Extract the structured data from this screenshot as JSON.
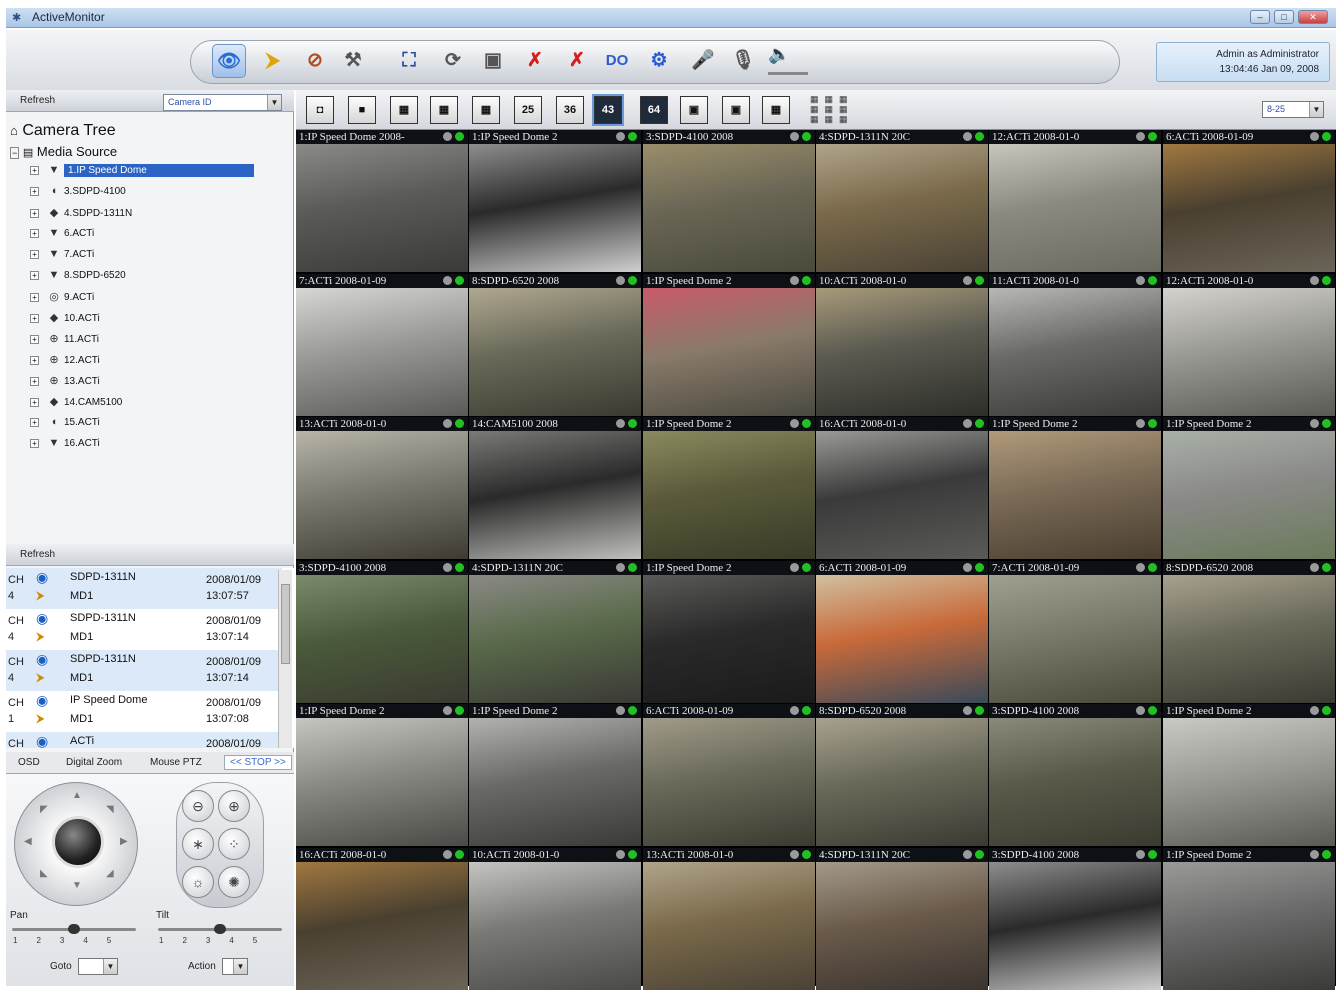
{
  "window": {
    "title": "ActiveMonitor"
  },
  "user": {
    "line1": "Admin as Administrator",
    "line2": "13:04:46 Jan 09, 2008"
  },
  "toolbar": {
    "buttons": [
      {
        "icon": "eye-icon",
        "glyph": "👁",
        "color": "#2a6cd4"
      },
      {
        "icon": "alarm-tag-icon",
        "glyph": "⮞",
        "color": "#e0a400"
      },
      {
        "icon": "map-edit-icon",
        "glyph": "⊘",
        "color": "#b05020"
      },
      {
        "icon": "tools-icon",
        "glyph": "⚒",
        "color": "#555"
      },
      {
        "icon": "fullscreen-icon",
        "glyph": "⛶",
        "color": "#2a4f9a"
      },
      {
        "icon": "sequence-icon",
        "glyph": "⟳",
        "color": "#555"
      },
      {
        "icon": "snapshot-icon",
        "glyph": "▣",
        "color": "#555"
      },
      {
        "icon": "disconnect-icon",
        "glyph": "✗",
        "color": "#d02020"
      },
      {
        "icon": "disconnect-all-icon",
        "glyph": "✗",
        "color": "#d02020"
      },
      {
        "icon": "digital-output-icon",
        "glyph": "DO",
        "color": "#2a5bd0"
      },
      {
        "icon": "settings-icon",
        "glyph": "⚙",
        "color": "#2a5bd0"
      },
      {
        "icon": "microphone-icon",
        "glyph": "🎤",
        "color": "#555"
      },
      {
        "icon": "talk-icon",
        "glyph": "🎙",
        "color": "#555"
      }
    ],
    "speaker_icon": "speaker-icon"
  },
  "left": {
    "header_refresh": "Refresh",
    "sort_select": "Camera ID",
    "tree_root": "Camera Tree",
    "media_source": "Media Source",
    "nodes": [
      {
        "label": "1.IP Speed Dome",
        "icon": "dome-camera-icon",
        "glyph": "▼",
        "selected": true
      },
      {
        "label": "3.SDPD-4100",
        "icon": "box-camera-icon",
        "glyph": "◖"
      },
      {
        "label": "4.SDPD-1311N",
        "icon": "bullet-camera-icon",
        "glyph": "◆"
      },
      {
        "label": "6.ACTi",
        "icon": "dome-camera-icon",
        "glyph": "▼"
      },
      {
        "label": "7.ACTi",
        "icon": "dome-camera-icon",
        "glyph": "▼"
      },
      {
        "label": "8.SDPD-6520",
        "icon": "dome-camera-icon",
        "glyph": "▼"
      },
      {
        "label": "9.ACTi",
        "icon": "wireless-camera-icon",
        "glyph": "◎"
      },
      {
        "label": "10.ACTi",
        "icon": "bullet-camera-icon",
        "glyph": "◆"
      },
      {
        "label": "11.ACTi",
        "icon": "network-camera-icon",
        "glyph": "⊕"
      },
      {
        "label": "12.ACTi",
        "icon": "network-camera-icon",
        "glyph": "⊕"
      },
      {
        "label": "13.ACTi",
        "icon": "network-camera-icon",
        "glyph": "⊕"
      },
      {
        "label": "14.CAM5100",
        "icon": "bullet-camera-icon",
        "glyph": "◆"
      },
      {
        "label": "15.ACTi",
        "icon": "box-camera-icon",
        "glyph": "◖"
      },
      {
        "label": "16.ACTi",
        "icon": "dome-camera-icon",
        "glyph": "▼"
      }
    ],
    "events_refresh": "Refresh",
    "events": [
      {
        "ch": "CH",
        "num": "4",
        "device": "SDPD-1311N",
        "trigger": "MD1",
        "date": "2008/01/09",
        "time": "13:07:57",
        "hl": true
      },
      {
        "ch": "CH",
        "num": "4",
        "device": "SDPD-1311N",
        "trigger": "MD1",
        "date": "2008/01/09",
        "time": "13:07:14",
        "hl": false
      },
      {
        "ch": "CH",
        "num": "4",
        "device": "SDPD-1311N",
        "trigger": "MD1",
        "date": "2008/01/09",
        "time": "13:07:14",
        "hl": true
      },
      {
        "ch": "CH",
        "num": "1",
        "device": "IP Speed Dome",
        "trigger": "MD1",
        "date": "2008/01/09",
        "time": "13:07:08",
        "hl": false
      },
      {
        "ch": "CH",
        "num": "",
        "device": "ACTi",
        "trigger": "",
        "date": "2008/01/09",
        "time": "",
        "hl": true
      }
    ],
    "ptz_tabs": {
      "osd": "OSD",
      "digital_zoom": "Digital Zoom",
      "mouse_ptz": "Mouse PTZ",
      "stop": "<< STOP >>"
    },
    "ptz": {
      "pan_label": "Pan",
      "tilt_label": "Tilt",
      "pan_ticks": "12345",
      "tilt_ticks": "12345",
      "goto_label": "Goto",
      "action_label": "Action"
    }
  },
  "view": {
    "layouts": [
      {
        "label": "◘",
        "icon": "layout-cycle-icon",
        "dark": false
      },
      {
        "label": "■",
        "icon": "layout-1-icon",
        "dark": false
      },
      {
        "label": "▦",
        "icon": "layout-4-icon",
        "dark": false
      },
      {
        "label": "▦",
        "icon": "layout-9-icon",
        "dark": false
      },
      {
        "label": "▦",
        "icon": "layout-16-icon",
        "dark": false
      },
      {
        "label": "25",
        "icon": "layout-25-icon",
        "dark": false
      },
      {
        "label": "36",
        "icon": "layout-36-icon",
        "dark": false
      },
      {
        "label": "43",
        "icon": "layout-43-icon",
        "dark": true
      },
      {
        "label": "64",
        "icon": "layout-64-icon",
        "dark": true
      },
      {
        "label": "▣",
        "icon": "layout-1plus5-icon",
        "dark": false
      },
      {
        "label": "▣",
        "icon": "layout-1plus7-icon",
        "dark": false
      },
      {
        "label": "▦",
        "icon": "layout-1plus12-icon",
        "dark": false
      }
    ],
    "page_select": "8-25"
  },
  "cells": [
    {
      "cap": "1:IP Speed Dome   2008-",
      "g": [
        "#5a5a58",
        "#8a8a86",
        "#3a3a38"
      ],
      "sel": true
    },
    {
      "cap": "1:IP Speed Dome   2",
      "g": [
        "#2a2a2a",
        "#8e8e8e",
        "#cfcfcf"
      ]
    },
    {
      "cap": "3:SDPD-4100   2008",
      "g": [
        "#6a6656",
        "#9a8e6a",
        "#4a4a3a"
      ]
    },
    {
      "cap": "4:SDPD-1311N   20C",
      "g": [
        "#7a6a4a",
        "#b0a48a",
        "#4a4236"
      ]
    },
    {
      "cap": "12:ACTi   2008-01-0",
      "g": [
        "#8a8a80",
        "#c9c6bb",
        "#6a6a60"
      ]
    },
    {
      "cap": "6:ACTi   2008-01-09",
      "g": [
        "#4a4030",
        "#a07840",
        "#6a6458"
      ]
    },
    {
      "cap": "7:ACTi   2008-01-09",
      "g": [
        "#9a9a96",
        "#d6d6d2",
        "#5a5a56"
      ]
    },
    {
      "cap": "8:SDPD-6520   2008",
      "g": [
        "#6a6a5a",
        "#b0a890",
        "#3a3a30"
      ]
    },
    {
      "cap": "1:IP Speed Dome   2",
      "g": [
        "#8a7a6a",
        "#c85a6a",
        "#4a4a40"
      ]
    },
    {
      "cap": "10:ACTi   2008-01-0",
      "g": [
        "#5a5a50",
        "#a89a7a",
        "#2e2e2a"
      ]
    },
    {
      "cap": "11:ACTi   2008-01-0",
      "g": [
        "#6a6a66",
        "#b8b8b4",
        "#3a3a36"
      ]
    },
    {
      "cap": "12:ACTi   2008-01-0",
      "g": [
        "#9a9a94",
        "#d4d2cc",
        "#5a5a54"
      ]
    },
    {
      "cap": "13:ACTi   2008-01-0",
      "g": [
        "#7a7a70",
        "#b8b4a8",
        "#3e3a32"
      ]
    },
    {
      "cap": "14:CAM5100   2008",
      "g": [
        "#2a2a2a",
        "#7a7a78",
        "#c0c0bc"
      ]
    },
    {
      "cap": "1:IP Speed Dome   2",
      "g": [
        "#5a5a3a",
        "#8a8a60",
        "#3a3a28"
      ]
    },
    {
      "cap": "16:ACTi   2008-01-0",
      "g": [
        "#3a3a3a",
        "#9a9a98",
        "#5a5a58"
      ]
    },
    {
      "cap": "1:IP Speed Dome   2",
      "g": [
        "#7a6a56",
        "#b09a7a",
        "#4a3e30"
      ]
    },
    {
      "cap": "1:IP Speed Dome   2",
      "g": [
        "#8a8a88",
        "#a9b0a8",
        "#6a7a5a"
      ]
    },
    {
      "cap": "3:SDPD-4100   2008",
      "g": [
        "#4a5a3a",
        "#7a8a6a",
        "#3a3a30"
      ]
    },
    {
      "cap": "4:SDPD-1311N   20C",
      "g": [
        "#5a6a4a",
        "#8a8a86",
        "#3a3a36"
      ]
    },
    {
      "cap": "1:IP Speed Dome   2",
      "g": [
        "#2a2a2a",
        "#5a5a58",
        "#1a1a1a"
      ]
    },
    {
      "cap": "6:ACTi   2008-01-09",
      "g": [
        "#c86a3a",
        "#d0c0a0",
        "#3a4a5a"
      ]
    },
    {
      "cap": "7:ACTi   2008-01-09",
      "g": [
        "#7a7a6a",
        "#a0a090",
        "#4a4a3a"
      ]
    },
    {
      "cap": "8:SDPD-6520   2008",
      "g": [
        "#6a6a5a",
        "#a8a090",
        "#3a3a32"
      ]
    },
    {
      "cap": "1:IP Speed Dome   2",
      "g": [
        "#8a8a84",
        "#c6c6c0",
        "#4a4a46"
      ]
    },
    {
      "cap": "1:IP Speed Dome   2",
      "g": [
        "#6a6a66",
        "#b2b2ae",
        "#3a3a36"
      ]
    },
    {
      "cap": "6:ACTi   2008-01-09",
      "g": [
        "#6a6a5a",
        "#a09a8a",
        "#3a3a30"
      ]
    },
    {
      "cap": "8:SDPD-6520   2008",
      "g": [
        "#6a6a5a",
        "#a8a090",
        "#3a3a32"
      ]
    },
    {
      "cap": "3:SDPD-4100   2008",
      "g": [
        "#5a5a4a",
        "#8a8a7a",
        "#3a3a30"
      ]
    },
    {
      "cap": "1:IP Speed Dome   2",
      "g": [
        "#9a9a94",
        "#cacac4",
        "#5a5a54"
      ]
    },
    {
      "cap": "16:ACTi   2008-01-0",
      "g": [
        "#4a4030",
        "#a07840",
        "#6a6458"
      ]
    },
    {
      "cap": "10:ACTi   2008-01-0",
      "g": [
        "#7a7a76",
        "#c4c4c0",
        "#4a4a46"
      ]
    },
    {
      "cap": "13:ACTi   2008-01-0",
      "g": [
        "#7a6a4a",
        "#b0a48a",
        "#4a4236"
      ]
    },
    {
      "cap": "4:SDPD-1311N   20C",
      "g": [
        "#6a5a4a",
        "#a49a8a",
        "#3a3430"
      ]
    },
    {
      "cap": "3:SDPD-4100   2008",
      "g": [
        "#2a2a2a",
        "#8e8e8e",
        "#cfcfcf"
      ]
    },
    {
      "cap": "1:IP Speed Dome   2",
      "g": [
        "#6a6a6a",
        "#9a9a98",
        "#3a3a38"
      ]
    }
  ]
}
